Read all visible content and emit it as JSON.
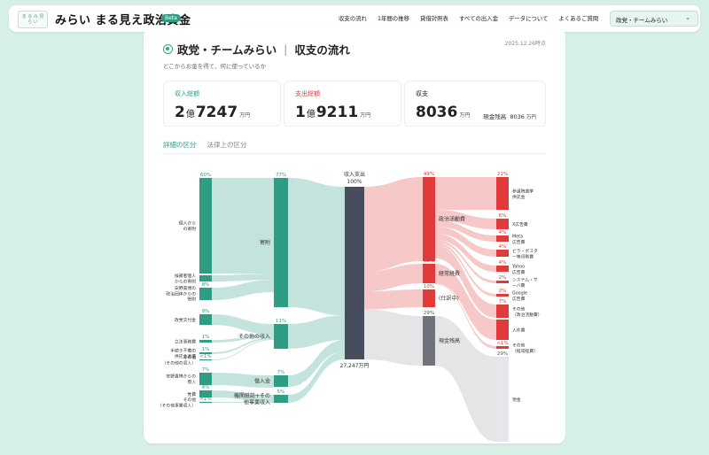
{
  "header": {
    "logo_text": "ま る み 見 ら い",
    "site_title": "みらい まる見え政治資金",
    "beta": "Beta",
    "nav": [
      "収支の流れ",
      "1年間の推移",
      "貸借対照表",
      "すべての出入金",
      "データについて",
      "よくあるご質問"
    ],
    "party_select": "政党・チームみらい"
  },
  "page": {
    "title": "政党・チームみらい",
    "title_sub": "収支の流れ",
    "date": "2025.12.26時点",
    "subtitle": "どこからお金を得て、何に使っているか"
  },
  "stats": {
    "income": {
      "label": "収入総額",
      "oku": "2",
      "man": "7247",
      "unit_oku": "億",
      "unit_man": "万円",
      "color": "#2f9c84"
    },
    "expense": {
      "label": "支出総額",
      "oku": "1",
      "man": "9211",
      "unit_oku": "億",
      "unit_man": "万円",
      "color": "#d83b3b"
    },
    "balance": {
      "label": "収支",
      "value": "8036",
      "unit": "万円",
      "cash_label": "現金残高",
      "cash_value": "8036",
      "cash_unit": "万円"
    }
  },
  "tabs": [
    "詳細の区分",
    "法律上の区分"
  ],
  "chart_data": {
    "type": "sankey",
    "colors": {
      "income": "#2f9c84",
      "expense": "#e03a3a",
      "center": "#474d5f",
      "cash": "#70737d"
    },
    "center": {
      "label": "収入支出",
      "pct": "100%",
      "total": "27,247万円"
    },
    "income_sources": [
      {
        "label": "個人からの寄附",
        "pct": "60%"
      },
      {
        "label": "候補者個人からの寄附",
        "pct": "9%"
      },
      {
        "label": "安野貴博の政治団体からの寄附",
        "pct": "8%"
      },
      {
        "label": "政党交付金",
        "pct": "9%"
      },
      {
        "label": "立法事務費",
        "pct": "1%"
      },
      {
        "label": "手続き不備の供託金返還",
        "pct": "1%"
      },
      {
        "label": "その他（その他の収入）",
        "pct": "<1%"
      },
      {
        "label": "安野貴博からの借入",
        "pct": "7%"
      },
      {
        "label": "党費",
        "pct": "4%"
      },
      {
        "label": "その他（その他事業収入）",
        "pct": "<1%"
      }
    ],
    "income_categories": [
      {
        "label": "寄附",
        "pct": "77%"
      },
      {
        "label": "その他の収入",
        "pct": "11%"
      },
      {
        "label": "借入金",
        "pct": "7%"
      },
      {
        "label": "機関紙誌+その他事業収入",
        "pct": "5%"
      }
    ],
    "expense_categories": [
      {
        "label": "政治活動費",
        "pct": "49%"
      },
      {
        "label": "経常経費",
        "pct": "12%"
      },
      {
        "label": "(仕訳中)",
        "pct": "10%"
      },
      {
        "label": "現金残高",
        "pct": "29%"
      }
    ],
    "expense_items": [
      {
        "label": "参議院選挙供託金",
        "pct": "21%"
      },
      {
        "label": "X広告費",
        "pct": "6%"
      },
      {
        "label": "Meta広告費",
        "pct": "4%"
      },
      {
        "label": "ビラ・ポスター等印刷費",
        "pct": "4%"
      },
      {
        "label": "Yahoo広告費",
        "pct": "4%"
      },
      {
        "label": "システム・サーバ費",
        "pct": "2%"
      },
      {
        "label": "Google広告費",
        "pct": "2%"
      },
      {
        "label": "その他（政治活動費）",
        "pct": "7%"
      },
      {
        "label": "人件費",
        "pct": "12%"
      },
      {
        "label": "その他（経常経費）",
        "pct": "<1%"
      },
      {
        "label": "現金",
        "pct": "29%"
      }
    ]
  }
}
